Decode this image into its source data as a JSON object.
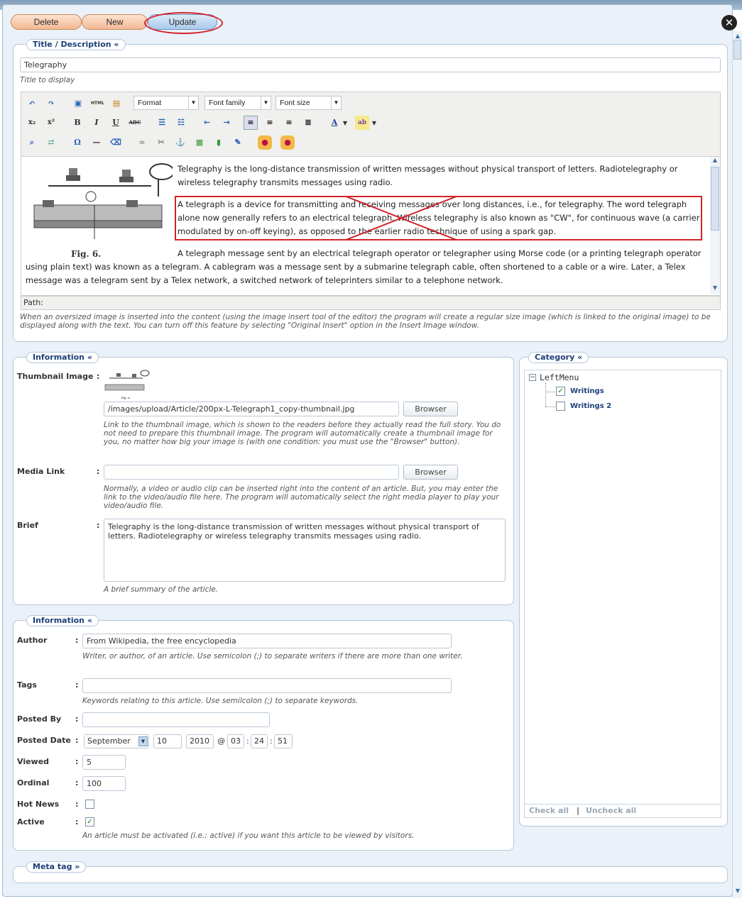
{
  "toolbar": {
    "delete_label": "Delete",
    "new_label": "New",
    "update_label": "Update",
    "close_icon": "close-icon"
  },
  "title_section": {
    "legend": "Title / Description «",
    "title_value": "Telegraphy",
    "title_hint": "Title to display",
    "editor": {
      "format": "Format",
      "font_family": "Font family",
      "font_size": "Font size",
      "paragraphs": [
        "Telegraphy is the long-distance transmission of written messages without physical transport of letters. Radiotelegraphy or wireless telegraphy transmits messages using radio.",
        "A telegraph is a device for transmitting and receiving messages over long distances, i.e., for telegraphy. The word telegraph alone now generally refers to an electrical telegraph. Wireless telegraphy is also known as \"CW\", for continuous wave (a carrier modulated by on-off keying), as opposed to the earlier radio technique of using a spark gap.",
        "A telegraph message sent by an electrical telegraph operator or telegrapher using Morse code (or a printing telegraph operator using plain text) was known as a telegram. A cablegram was a message sent by a submarine telegraph cable, often shortened to a cable or a wire. Later, a Telex message was a telegram sent by a Telex network, a switched network of teleprinters similar to a telephone network."
      ],
      "figure_caption": "Fig. 6.",
      "path_label": "Path:"
    },
    "editor_hint": "When an oversized image is inserted into the content (using the image insert tool of the editor) the program will create a regular size image (which is linked to the original image) to be displayed along with the text. You can turn off this feature by selecting \"Original Insert\" option in the Insert Image window."
  },
  "info1": {
    "legend": "Information «",
    "thumbnail_label": "Thumbnail Image",
    "thumbnail_caption": "Fig. 6.",
    "thumbnail_path": "/images/upload/Article/200px-L-Telegraph1_copy-thumbnail.jpg",
    "browser_label": "Browser",
    "thumbnail_hint": "Link to the thumbnail image, which is shown to the readers before they actually read the full story. You do not need to prepare this thumbnail image. The program will automatically create a thumbnail image for you, no matter how big your image is (with one condition: you must use the \"Browser\" button).",
    "media_label": "Media Link",
    "media_value": "",
    "media_hint": "Normally, a video or audio clip can be inserted right into the content of an article. But, you may enter the link to the video/audio file here. The program will automatically select the right media player to play your video/audio file.",
    "brief_label": "Brief",
    "brief_value": "Telegraphy is the long-distance transmission of written messages without physical transport of letters. Radiotelegraphy or wireless telegraphy transmits messages using radio.",
    "brief_hint": "A brief summary of the article."
  },
  "info2": {
    "legend": "Information «",
    "author_label": "Author",
    "author_value": "From Wikipedia, the free encyclopedia",
    "author_hint": "Writer, or author, of an article. Use semicolon (;) to separate writers if there are more than one writer.",
    "tags_label": "Tags",
    "tags_value": "",
    "tags_hint": "Keywords relating to this article. Use semilcolon (;) to separate keywords.",
    "posted_by_label": "Posted By",
    "posted_by_value": "",
    "posted_date_label": "Posted Date",
    "month": "September",
    "day": "10",
    "year": "2010",
    "hour": "03",
    "minute": "24",
    "second": "51",
    "viewed_label": "Viewed",
    "viewed_value": "5",
    "ordinal_label": "Ordinal",
    "ordinal_value": "100",
    "hotnews_label": "Hot News",
    "hotnews_checked": false,
    "active_label": "Active",
    "active_checked": true,
    "active_hint": "An article must be activated (i.e.: active) if you want this article to be viewed by visitors."
  },
  "category": {
    "legend": "Category «",
    "root": "LeftMenu",
    "items": [
      {
        "label": "Writings",
        "checked": true
      },
      {
        "label": "Writings 2",
        "checked": false
      }
    ],
    "check_all": "Check all",
    "separator": "|",
    "uncheck_all": "Uncheck all"
  },
  "meta": {
    "legend": "Meta tag »"
  },
  "colors": {
    "accent": "#1d3f7a",
    "annotation": "#d2232a"
  }
}
